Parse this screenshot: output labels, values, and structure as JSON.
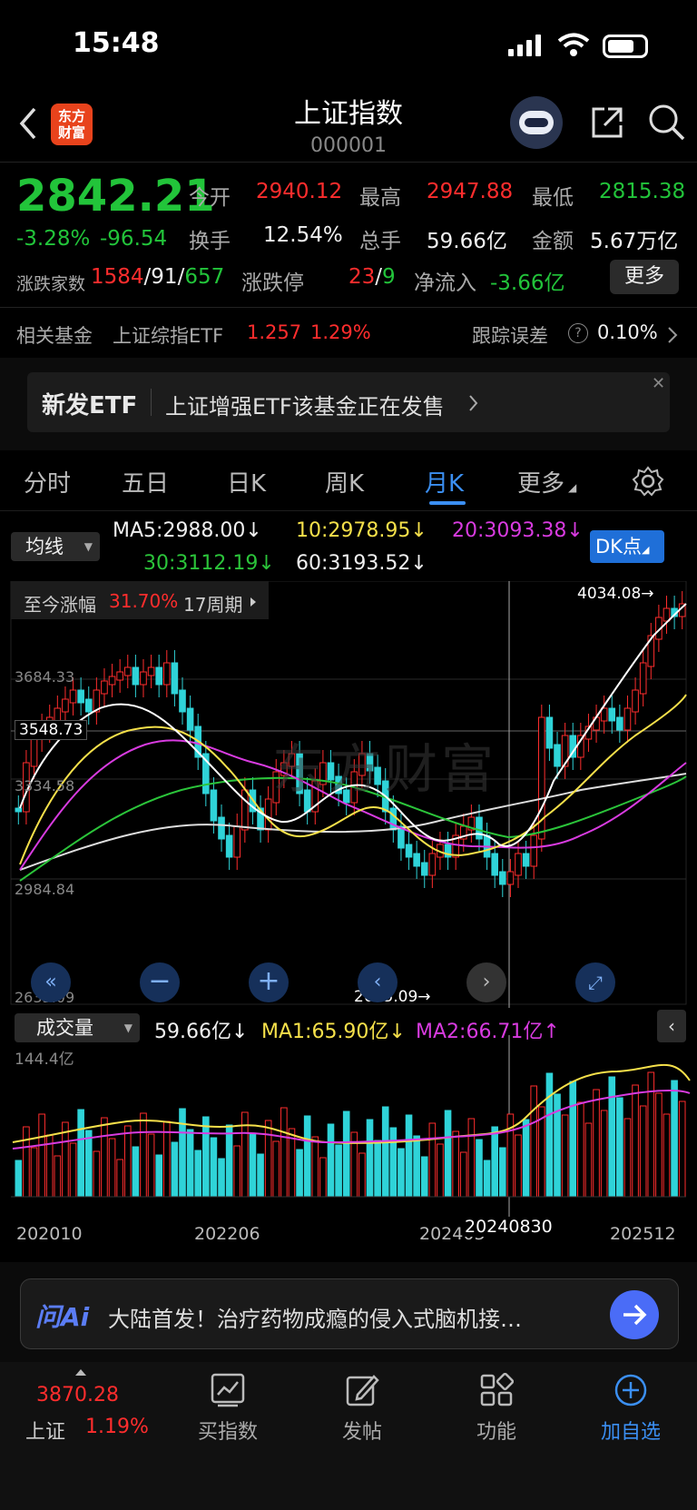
{
  "status": {
    "time": "15:48"
  },
  "header": {
    "title": "上证指数",
    "code": "000001",
    "logo_line1": "东方",
    "logo_line2": "财富"
  },
  "quote": {
    "price": "2842.21",
    "change_pct": "-3.28%",
    "change": "-96.54",
    "open_label": "今开",
    "open": "2940.12",
    "high_label": "最高",
    "high": "2947.88",
    "low_label": "最低",
    "low": "2815.38",
    "turnover_label": "换手",
    "turnover": "12.54%",
    "volume_label": "总手",
    "volume": "59.66亿",
    "amount_label": "金额",
    "amount": "5.67万亿",
    "breadth_label": "涨跌家数",
    "breadth_up": "1584",
    "breadth_flat": "91",
    "breadth_down": "657",
    "limit_label": "涨跌停",
    "limit_up": "23",
    "limit_down": "9",
    "inflow_label": "净流入",
    "inflow": "-3.66亿",
    "more_button": "更多"
  },
  "fund": {
    "label": "相关基金",
    "name": "上证综指ETF",
    "price": "1.257",
    "pct": "1.29%",
    "tracking_label": "跟踪误差",
    "tracking": "0.10%"
  },
  "banner": {
    "tag": "新发ETF",
    "text": "上证增强ETF该基金正在发售"
  },
  "tabs": [
    "分时",
    "五日",
    "日K",
    "周K",
    "月K",
    "更多"
  ],
  "indicator": {
    "select": "均线",
    "ma5": "MA5:2988.00",
    "ma10": "10:2978.95",
    "ma20": "20:3093.38",
    "ma30": "30:3112.19",
    "ma60": "60:3193.52",
    "dk_button": "DK点"
  },
  "period": {
    "label": "至今涨幅",
    "pct": "31.70%",
    "periods": "17周期"
  },
  "chart_labels": {
    "y1": "3684.33",
    "y2": "3548.73",
    "y3": "3334.58",
    "y4": "2984.84",
    "y5": "2635.09",
    "max_marker": "4034.08→",
    "min_marker": "2635.09→",
    "x1": "202010",
    "x2": "202206",
    "x3": "202403",
    "x4": "202512",
    "crosshair_date": "20240830"
  },
  "volume_panel": {
    "select": "成交量",
    "vol": "59.66亿",
    "ma1": "MA1:65.90亿",
    "ma2": "MA2:66.71亿",
    "max_label": "144.4亿"
  },
  "ai": {
    "logo": "问Ai",
    "text": "大陆首发！治疗药物成瘾的侵入式脑机接…"
  },
  "bottom": {
    "index_value": "3870.28",
    "index_name": "上证",
    "index_pct": "1.19%",
    "nav": [
      "买指数",
      "发帖",
      "功能",
      "加自选"
    ]
  },
  "colors": {
    "up": "#ff2d2d",
    "down": "#22c43a",
    "accent": "#3b8ff2",
    "candle_down": "#2fd3d8"
  }
}
